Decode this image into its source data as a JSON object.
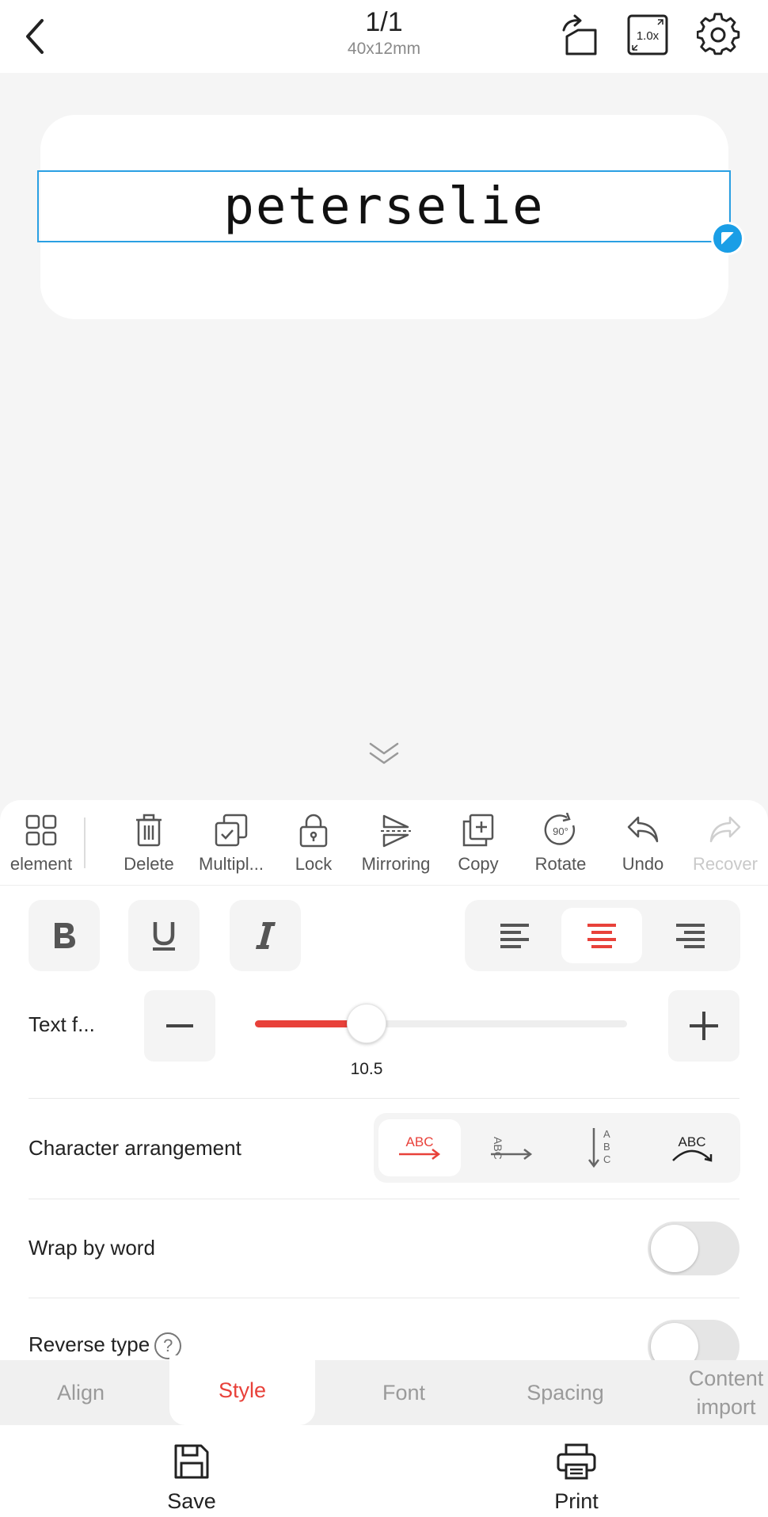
{
  "header": {
    "page_counter": "1/1",
    "label_size": "40x12mm",
    "zoom_label": "1.0x"
  },
  "canvas": {
    "text": "peterselie"
  },
  "toolbar": {
    "items": [
      {
        "label": "element"
      },
      {
        "label": "Delete"
      },
      {
        "label": "Multipl..."
      },
      {
        "label": "Lock"
      },
      {
        "label": "Mirroring"
      },
      {
        "label": "Copy"
      },
      {
        "label": "Rotate",
        "icon_text": "90°"
      },
      {
        "label": "Undo"
      },
      {
        "label": "Recover",
        "disabled": true
      }
    ]
  },
  "style_panel": {
    "text_size_label": "Text f...",
    "text_size_value": "10.5",
    "text_size_fraction": 0.3,
    "char_arrangement_label": "Character arrangement",
    "char_arrangement_glyph": "ABC",
    "wrap_by_word_label": "Wrap by word",
    "wrap_by_word_on": false,
    "reverse_type_label": "Reverse type",
    "reverse_type_on": false,
    "help_glyph": "?"
  },
  "tabs": {
    "items": [
      {
        "label": "Align"
      },
      {
        "label": "Style",
        "active": true
      },
      {
        "label": "Font"
      },
      {
        "label": "Spacing"
      },
      {
        "label": "Content import"
      }
    ]
  },
  "bottom": {
    "save_label": "Save",
    "print_label": "Print"
  },
  "colors": {
    "accent": "#e8413a",
    "selection": "#2aa0e3"
  }
}
